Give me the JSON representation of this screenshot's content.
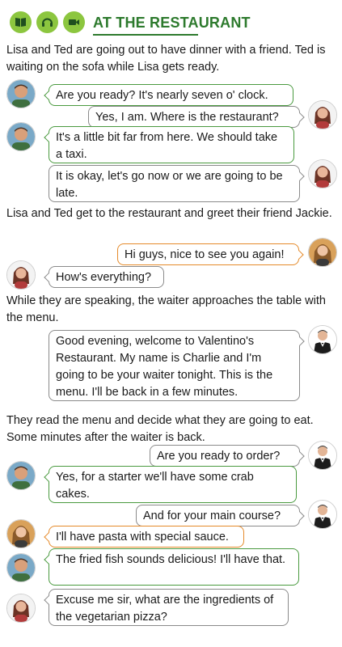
{
  "header": {
    "title": "AT THE RESTAURANT",
    "icons": [
      "book-icon",
      "headphones-icon",
      "video-camera-icon"
    ],
    "accent": "#8cc63f",
    "title_color": "#2d7a2d"
  },
  "narration": [
    "Lisa and Ted are going out to have dinner with a friend.  Ted is waiting on the sofa while Lisa gets ready.",
    "Lisa and Ted get to the restaurant and greet their friend Jackie.",
    "While they are speaking, the waiter approaches the table with the menu.",
    "They read the menu and decide what they are going to eat. Some minutes after the waiter is back."
  ],
  "dialogue": [
    {
      "speaker": "Ted",
      "text": "Are you ready? It's nearly seven o' clock."
    },
    {
      "speaker": "Lisa",
      "text": "Yes, I am. Where is the restaurant?"
    },
    {
      "speaker": "Ted",
      "text": "It's a little bit far from here. We should take a taxi."
    },
    {
      "speaker": "Lisa",
      "text": "It is okay, let's go now or we are going to be late."
    },
    {
      "speaker": "Jackie",
      "text": "Hi guys, nice to see you again!"
    },
    {
      "speaker": "Lisa",
      "text": "How's everything?"
    },
    {
      "speaker": "Charlie",
      "text": "Good evening, welcome to Valentino's Restaurant. My name is Charlie and I'm going to be your waiter tonight. This is the menu. I'll be back in a few minutes."
    },
    {
      "speaker": "Charlie",
      "text": "Are you ready to order?"
    },
    {
      "speaker": "Ted",
      "text": "Yes, for a starter we'll have some crab cakes."
    },
    {
      "speaker": "Charlie",
      "text": "And for your main course?"
    },
    {
      "speaker": "Jackie",
      "text": "I'll have pasta with special sauce."
    },
    {
      "speaker": "Ted",
      "text": "The fried fish sounds delicious! I'll have that."
    },
    {
      "speaker": "Lisa",
      "text": "Excuse me sir, what are the ingredients of the vegetarian pizza?"
    }
  ],
  "colors": {
    "ted_border": "#4a9a3f",
    "lisa_border": "#8a8a8a",
    "jackie_border": "#e58a2a",
    "waiter_border": "#8a8a8a"
  }
}
